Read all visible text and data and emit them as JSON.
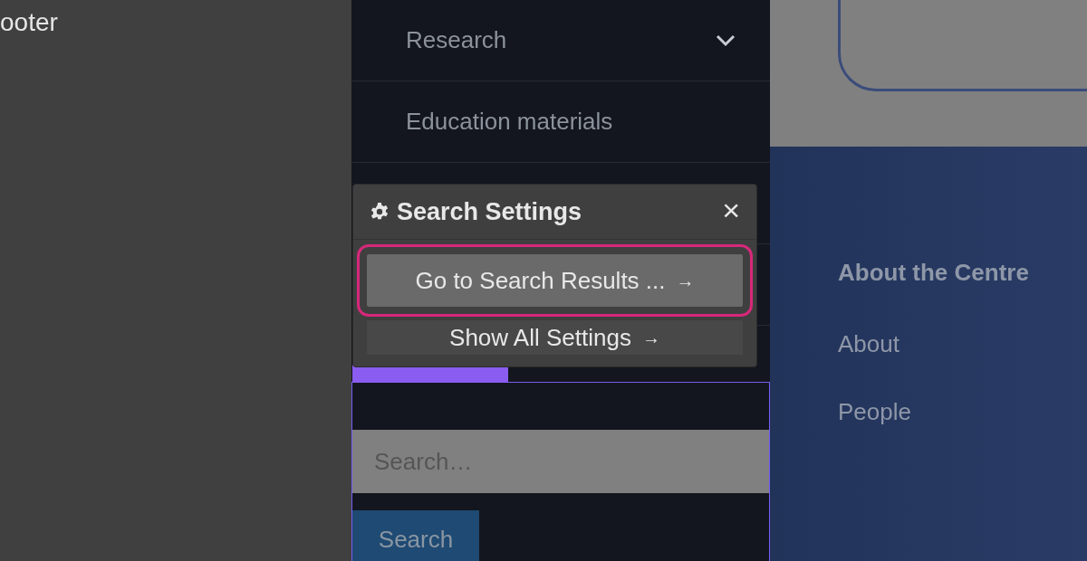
{
  "left_panel": {
    "label": "ooter"
  },
  "nav_items": [
    {
      "label": "Research",
      "expanded": false,
      "kind": "dropdown"
    },
    {
      "label": "Education materials",
      "kind": "link"
    }
  ],
  "search_block": {
    "placeholder": "Search…",
    "button": "Search"
  },
  "footer": {
    "heading": "About the Centre",
    "links": [
      "About",
      "People"
    ]
  },
  "popover": {
    "title": "Search Settings",
    "close": "×",
    "actions": [
      {
        "label": "Go to Search Results ...",
        "arrow": "→",
        "selected": true
      },
      {
        "label": "Show All Settings",
        "arrow": "→",
        "selected": false
      }
    ]
  }
}
